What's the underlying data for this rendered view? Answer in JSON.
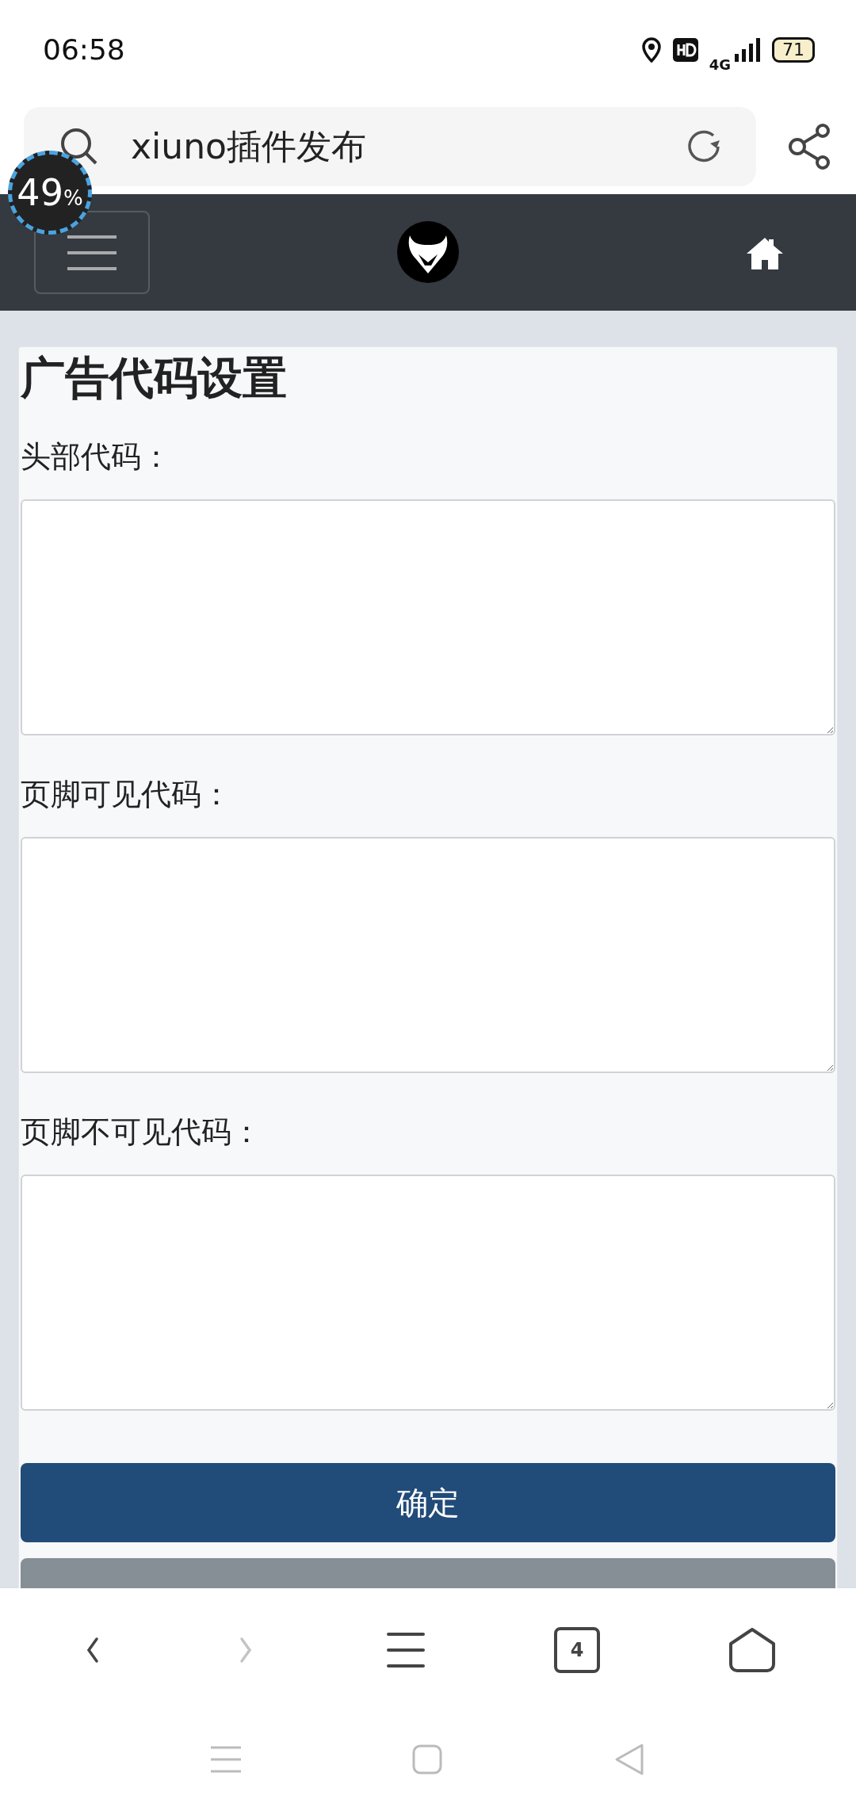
{
  "status_bar": {
    "time": "06:58",
    "battery": "71",
    "network": "4G"
  },
  "address_bar": {
    "value": "xiuno插件发布"
  },
  "speed_badge": {
    "value": "49",
    "unit": "%"
  },
  "page": {
    "title": "广告代码设置",
    "fields": [
      {
        "label": "头部代码："
      },
      {
        "label": "页脚可见代码："
      },
      {
        "label": "页脚不可见代码："
      }
    ],
    "buttons": [
      {
        "kind": "primary",
        "label": "确定"
      },
      {
        "kind": "secondary"
      }
    ]
  },
  "browser_toolbar": {
    "nav": [
      {
        "kind": "back",
        "disabled": false
      },
      {
        "kind": "forward",
        "disabled": true
      }
    ],
    "tab_count": "4"
  }
}
